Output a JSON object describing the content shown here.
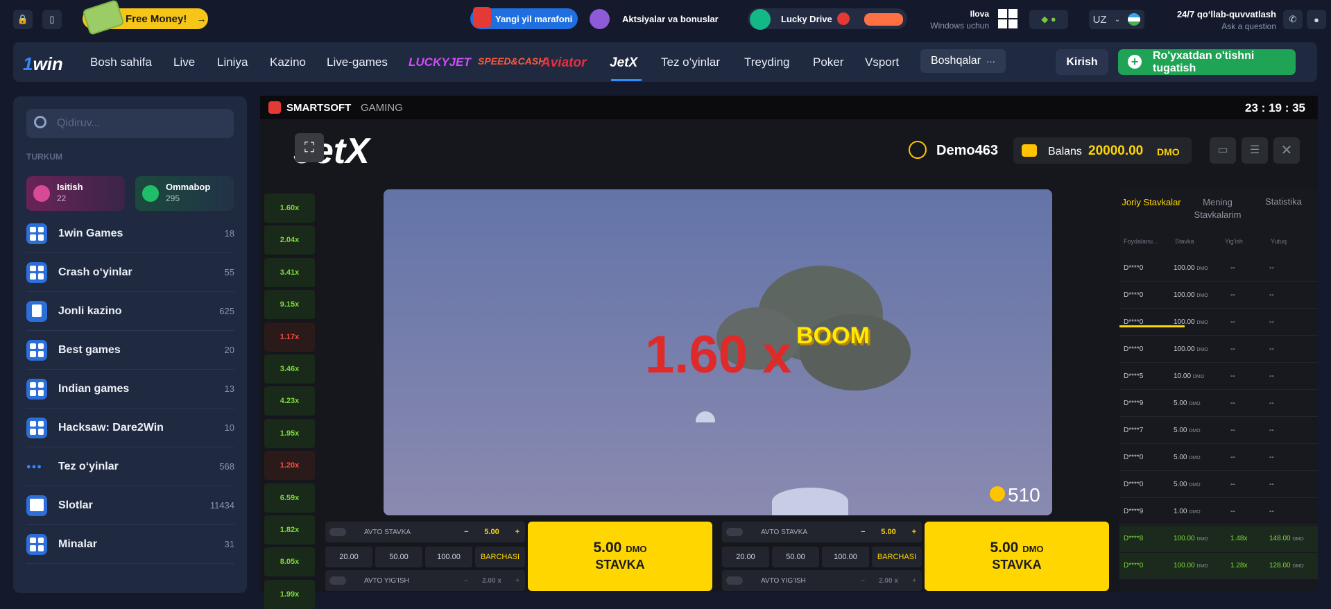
{
  "topbar": {
    "free_money": "Free Money!",
    "marathon": "Yangi yil marafoni",
    "promos": "Aktsiyalar va bonuslar",
    "lucky_drive": "Lucky Drive",
    "app_title": "Ilova",
    "app_sub": "Windows uchun",
    "lang": "UZ",
    "support_title": "24/7 qo‘llab-quvvatlash",
    "support_sub": "Ask a question"
  },
  "nav": {
    "logo_a": "1",
    "logo_b": "win",
    "items": [
      "Bosh sahifa",
      "Live",
      "Liniya",
      "Kazino",
      "Live-games",
      "LUCKYJET",
      "SPEED&CASH",
      "Aviator",
      "JetX",
      "Tez o‘yinlar",
      "Treyding",
      "Poker",
      "Vsport"
    ],
    "more": "Boshqalar",
    "more_dots": "···",
    "login": "Kirish",
    "register": "Ro'yxatdan o'tishni tugatish",
    "register_plus": "+"
  },
  "sidebar": {
    "search_placeholder": "Qidiruv...",
    "section": "TURKUM",
    "cat1": {
      "label": "Isitish",
      "count": "22"
    },
    "cat2": {
      "label": "Ommabop",
      "count": "295"
    },
    "rows": [
      {
        "label": "1win Games",
        "count": "18"
      },
      {
        "label": "Crash o‘yinlar",
        "count": "55"
      },
      {
        "label": "Jonli kazino",
        "count": "625"
      },
      {
        "label": "Best games",
        "count": "20"
      },
      {
        "label": "Indian games",
        "count": "13"
      },
      {
        "label": "Hacksaw: Dare2Win",
        "count": "10"
      },
      {
        "label": "Tez o‘yinlar",
        "count": "568"
      },
      {
        "label": "Slotlar",
        "count": "11434"
      },
      {
        "label": "Minalar",
        "count": "31"
      }
    ]
  },
  "game": {
    "provider_a": "SMARTSOFT",
    "provider_b": "GAMING",
    "clock": "23 : 19 : 35",
    "brand": "JetX",
    "user": "Demo463",
    "balance_label": "Balans",
    "balance": "20000.00",
    "currency": "DMO",
    "multiplier": "1.60 x",
    "boom": "BOOM",
    "players": "510",
    "history": [
      "1.60x",
      "2.04x",
      "3.41x",
      "9.15x",
      "1.17x",
      "3.46x",
      "4.23x",
      "1.95x",
      "1.20x",
      "6.59x",
      "1.82x",
      "8.05x",
      "1.99x"
    ],
    "tabs": [
      "Joriy Stavkalar",
      "Mening Stavkalarim",
      "Statistika"
    ],
    "cols": [
      "Foydalanu...",
      "Stavka",
      "Yig'ish",
      "Yutuq"
    ],
    "bets": [
      {
        "u": "D****0",
        "s": "100.00",
        "c": "--",
        "w": "--"
      },
      {
        "u": "D****0",
        "s": "100.00",
        "c": "--",
        "w": "--"
      },
      {
        "u": "D****0",
        "s": "100.00",
        "c": "--",
        "w": "--"
      },
      {
        "u": "D****0",
        "s": "100.00",
        "c": "--",
        "w": "--"
      },
      {
        "u": "D****5",
        "s": "10.00",
        "c": "--",
        "w": "--"
      },
      {
        "u": "D****9",
        "s": "5.00",
        "c": "--",
        "w": "--"
      },
      {
        "u": "D****7",
        "s": "5.00",
        "c": "--",
        "w": "--"
      },
      {
        "u": "D****0",
        "s": "5.00",
        "c": "--",
        "w": "--"
      },
      {
        "u": "D****0",
        "s": "5.00",
        "c": "--",
        "w": "--"
      },
      {
        "u": "D****9",
        "s": "1.00",
        "c": "--",
        "w": "--"
      },
      {
        "u": "D****8",
        "s": "100.00",
        "c": "1.48x",
        "w": "148.00"
      },
      {
        "u": "D****0",
        "s": "100.00",
        "c": "1.28x",
        "w": "128.00"
      }
    ],
    "panel": {
      "auto_bet": "AVTO STAVKA",
      "auto_cash": "AVTO YIG'ISH",
      "bet_value": "5.00",
      "cash_value": "2.00 x",
      "quick": [
        "20.00",
        "50.00",
        "100.00"
      ],
      "all": "BARCHASI",
      "btn_amount": "5.00",
      "btn_label": "STAVKA"
    }
  }
}
